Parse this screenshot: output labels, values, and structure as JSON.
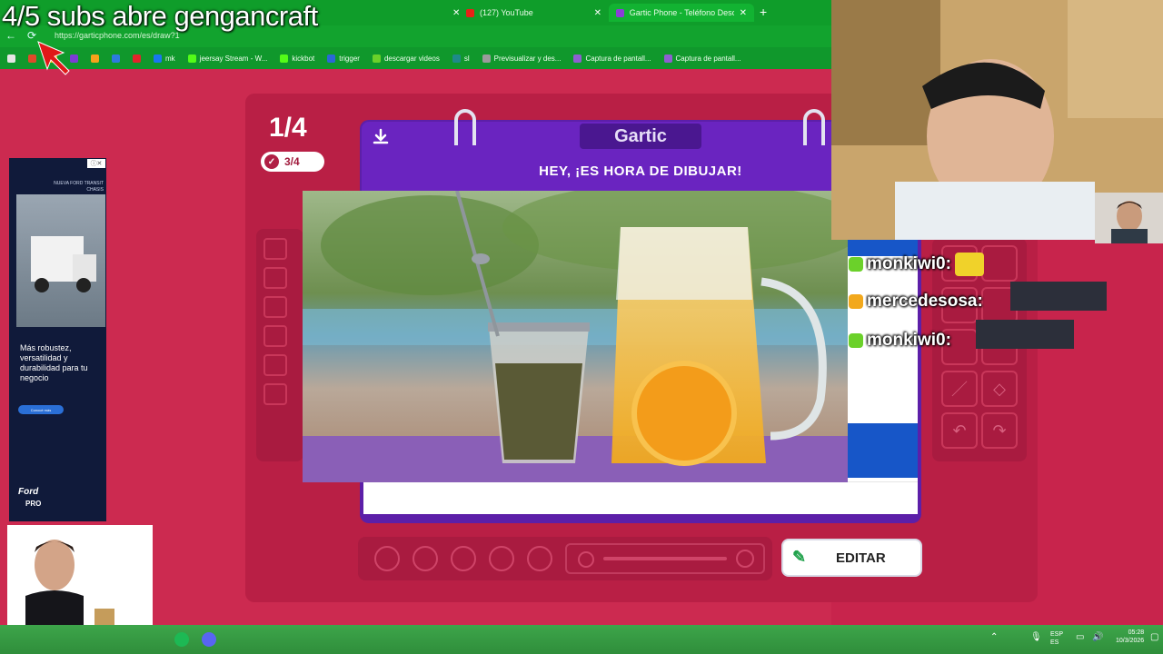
{
  "overlay": {
    "title": "4/5 subs abre gengancraft"
  },
  "browser": {
    "tabs": [
      {
        "label": "(127) YouTube",
        "active": false
      },
      {
        "label": "Gartic Phone - Teléfono Descomp",
        "active": true
      }
    ],
    "url": "https://garticphone.com/es/draw?1",
    "bookmarks": [
      "mk",
      "jeersay Stream - W...",
      "kickbot",
      "trigger",
      "descargar videos",
      "sl",
      "Previsualizar y des...",
      "Captura de pantall...",
      "Captura de pantall..."
    ]
  },
  "game": {
    "round": "1/4",
    "done_count": "3/4",
    "logo": "Gartic",
    "headline": "HEY, ¡ES HORA DE DIBUJAR!",
    "edit_label": "EDITAR"
  },
  "chat": [
    {
      "user": "monkiwi0:"
    },
    {
      "user": "mercedesosa:"
    },
    {
      "user": "monkiwi0:"
    }
  ],
  "ad": {
    "header": "NUEVA FORD TRANSIT CHASIS",
    "body": "Más robustez, versatilidad y durabilidad para tu negocio",
    "cta": "Conocé más",
    "brand": "Ford",
    "brand_sub": "PRO"
  },
  "taskbar": {
    "lang": "ESP",
    "region": "ES",
    "time": "05:28",
    "date": "10/3/2026"
  },
  "colors": {
    "page_bg": "#cc2a50",
    "paper_purple": "#6a24c0",
    "browser_green": "#10982c"
  }
}
